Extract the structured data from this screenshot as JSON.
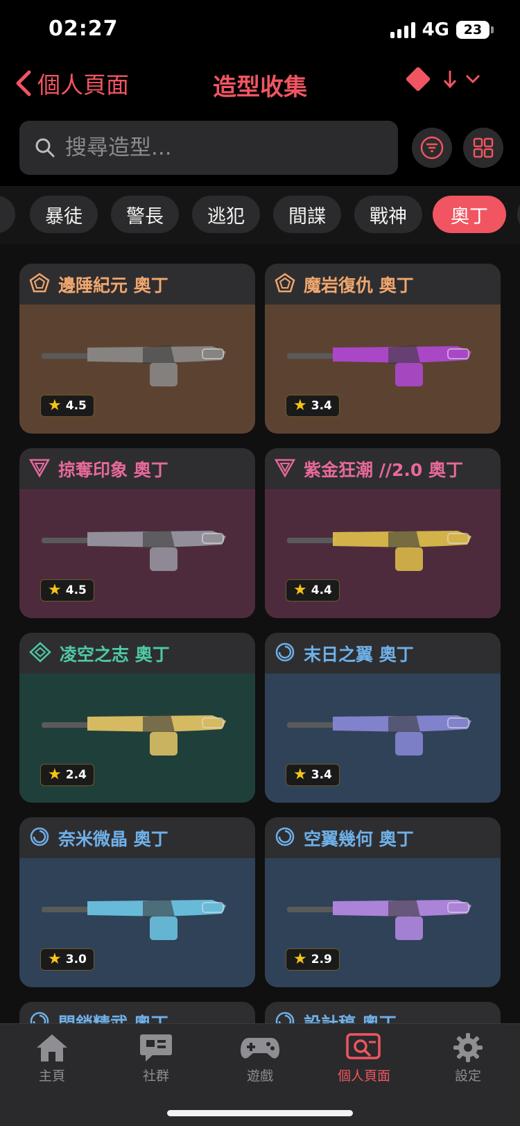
{
  "status_bar": {
    "time": "02:27",
    "network": "4G",
    "battery": "23"
  },
  "header": {
    "back_label": "個人頁面",
    "title": "造型收集"
  },
  "search": {
    "placeholder": "搜尋造型..."
  },
  "tabs": [
    "暴徒",
    "警長",
    "逃犯",
    "間諜",
    "戰神",
    "奧丁"
  ],
  "active_tab": "奧丁",
  "colors": {
    "accent": "#f05561",
    "rating_star": "#f5c518"
  },
  "skins": [
    {
      "name": "邊陲紀元 奧丁",
      "rating": "4.5",
      "tier": "pentagon-icon",
      "name_color": "#f0a76e",
      "bg": "#5c4331"
    },
    {
      "name": "魔岩復仇 奧丁",
      "rating": "3.4",
      "tier": "pentagon-icon",
      "name_color": "#f0a76e",
      "bg": "#5c4331"
    },
    {
      "name": "掠奪印象 奧丁",
      "rating": "4.5",
      "tier": "triangle-icon",
      "name_color": "#e8699b",
      "bg": "#4d2b3d"
    },
    {
      "name": "紫金狂潮 //2.0 奧丁",
      "rating": "4.4",
      "tier": "triangle-icon",
      "name_color": "#e8699b",
      "bg": "#4d2b3d"
    },
    {
      "name": "凌空之志 奧丁",
      "rating": "2.4",
      "tier": "diamond-icon",
      "name_color": "#4fc9a6",
      "bg": "#1f3f3a"
    },
    {
      "name": "末日之翼 奧丁",
      "rating": "3.4",
      "tier": "circle-icon",
      "name_color": "#6fb0e8",
      "bg": "#2f4258"
    },
    {
      "name": "奈米微晶 奧丁",
      "rating": "3.0",
      "tier": "circle-icon",
      "name_color": "#6fb0e8",
      "bg": "#2f4258"
    },
    {
      "name": "空翼幾何 奧丁",
      "rating": "2.9",
      "tier": "circle-icon",
      "name_color": "#6fb0e8",
      "bg": "#2f4258"
    },
    {
      "name": "閃銷精武 奧丁",
      "rating": "",
      "tier": "circle-icon",
      "name_color": "#6fb0e8",
      "bg": "#2f4258"
    },
    {
      "name": "設計稿 奧丁",
      "rating": "",
      "tier": "circle-icon",
      "name_color": "#6fb0e8",
      "bg": "#2f4258"
    }
  ],
  "nav": [
    {
      "label": "主頁",
      "icon": "home-icon"
    },
    {
      "label": "社群",
      "icon": "chat-icon"
    },
    {
      "label": "遊戲",
      "icon": "gamepad-icon"
    },
    {
      "label": "個人頁面",
      "icon": "profile-search-icon"
    },
    {
      "label": "設定",
      "icon": "gear-icon"
    }
  ]
}
